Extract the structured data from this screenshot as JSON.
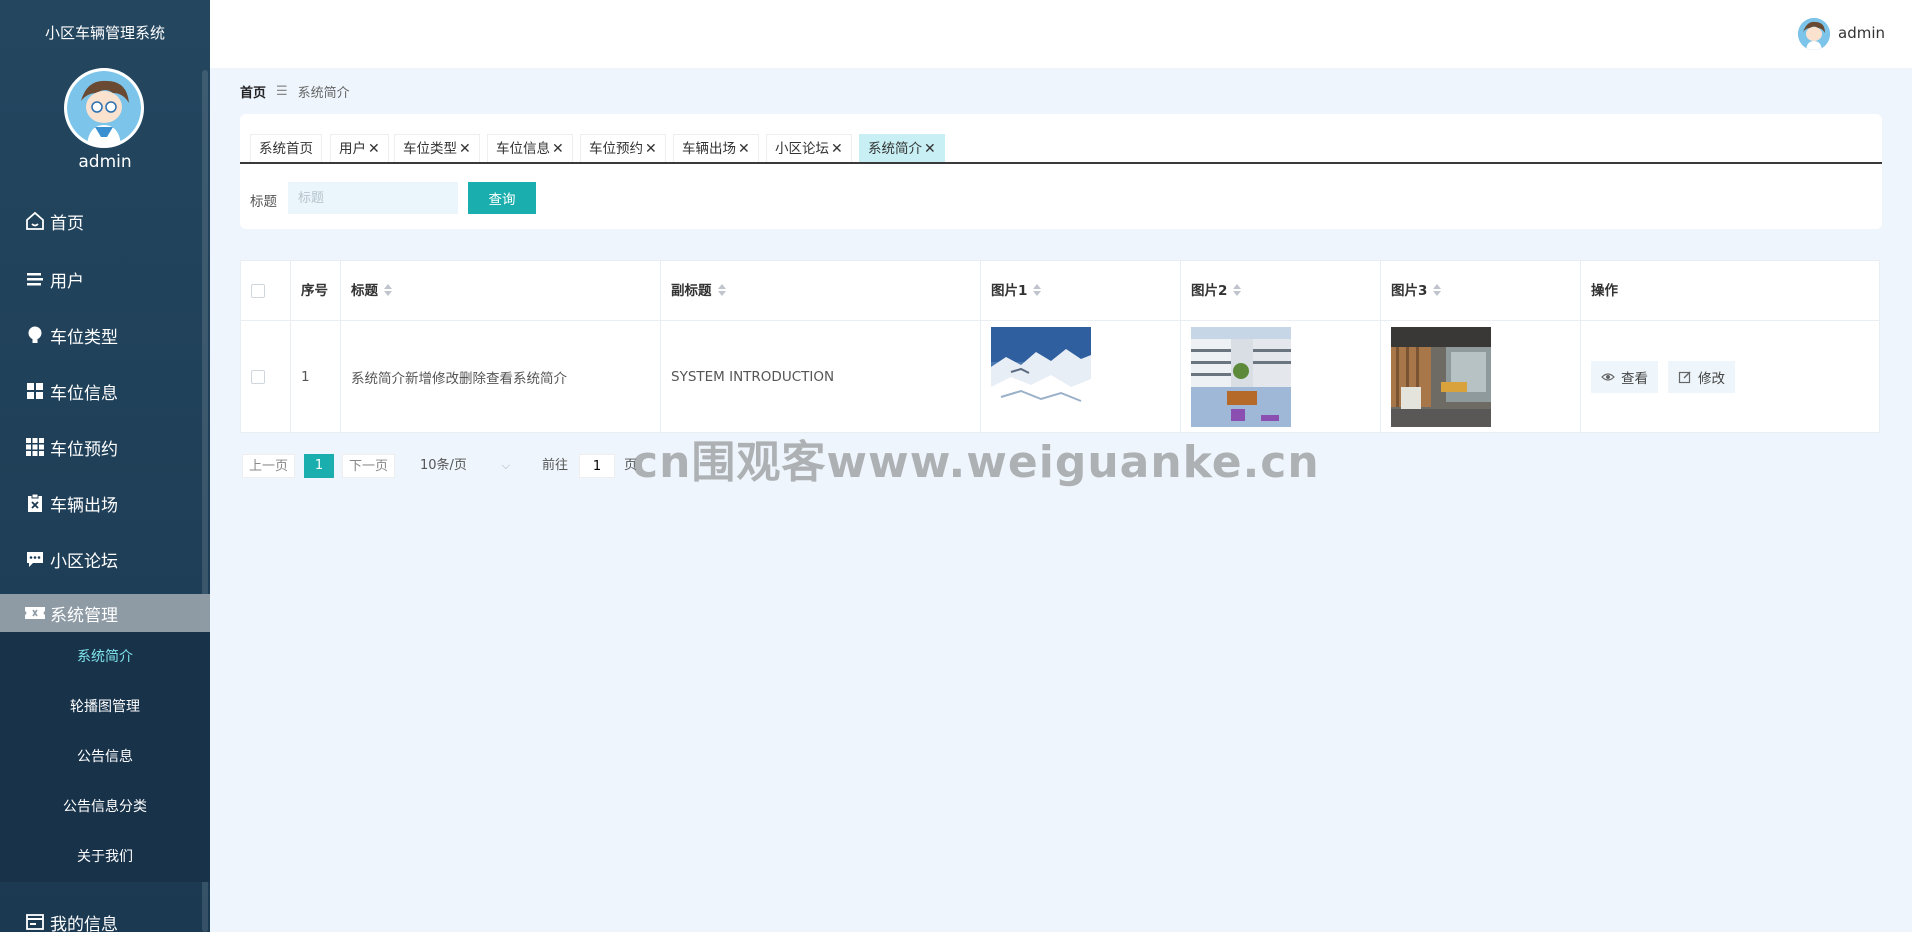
{
  "app": {
    "title": "小区车辆管理系统",
    "username": "admin"
  },
  "sidebar": {
    "items": [
      {
        "label": "首页",
        "icon": "home-icon"
      },
      {
        "label": "用户",
        "icon": "list-icon"
      },
      {
        "label": "车位类型",
        "icon": "bulb-icon"
      },
      {
        "label": "车位信息",
        "icon": "grid-icon"
      },
      {
        "label": "车位预约",
        "icon": "apps-icon"
      },
      {
        "label": "车辆出场",
        "icon": "clipboard-icon"
      },
      {
        "label": "小区论坛",
        "icon": "chat-icon"
      },
      {
        "label": "系统管理",
        "icon": "ticket-icon",
        "active": true
      },
      {
        "label": "我的信息",
        "icon": "card-icon"
      }
    ],
    "submenu": [
      "系统简介",
      "轮播图管理",
      "公告信息",
      "公告信息分类",
      "关于我们"
    ]
  },
  "header": {
    "username": "admin"
  },
  "breadcrumb": {
    "home": "首页",
    "separator": "☰",
    "current": "系统简介"
  },
  "tabs": [
    {
      "label": "系统首页",
      "closable": false
    },
    {
      "label": "用户",
      "closable": true
    },
    {
      "label": "车位类型",
      "closable": true
    },
    {
      "label": "车位信息",
      "closable": true
    },
    {
      "label": "车位预约",
      "closable": true
    },
    {
      "label": "车辆出场",
      "closable": true
    },
    {
      "label": "小区论坛",
      "closable": true
    },
    {
      "label": "系统简介",
      "closable": true,
      "active": true
    }
  ],
  "search": {
    "label": "标题",
    "placeholder": "标题",
    "button": "查询"
  },
  "table": {
    "columns": [
      "序号",
      "标题",
      "副标题",
      "图片1",
      "图片2",
      "图片3",
      "操作"
    ],
    "rows": [
      {
        "index": "1",
        "title": "系统简介新增修改删除查看系统简介",
        "subtitle": "SYSTEM INTRODUCTION"
      }
    ],
    "actions": {
      "view": "查看",
      "edit": "修改"
    }
  },
  "pagination": {
    "prev": "上一页",
    "current": "1",
    "next": "下一页",
    "page_size": "10条/页",
    "goto": "前往",
    "goto_value": "1",
    "page_unit": "页"
  },
  "watermark": "cn围观客www.weiguanke.cn",
  "colors": {
    "sidebar": "#1b3a52",
    "accent": "#1aaeae",
    "active_menu": "#8e9ba5",
    "active_tab": "#c8f0f4"
  }
}
